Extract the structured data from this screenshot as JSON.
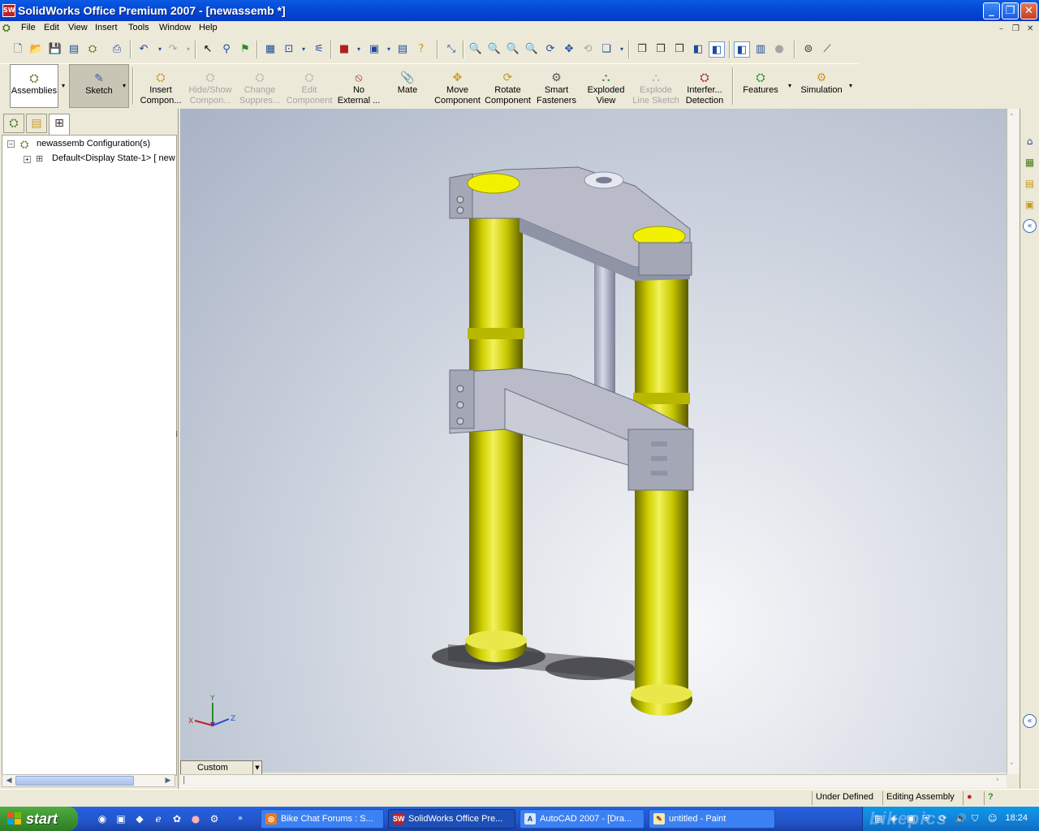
{
  "window": {
    "title": "SolidWorks Office Premium 2007 - [newassemb *]",
    "app_icon": "SW"
  },
  "menu": [
    "File",
    "Edit",
    "View",
    "Insert",
    "Tools",
    "Window",
    "Help"
  ],
  "command_manager": {
    "items": [
      {
        "label1": "Assemblies",
        "label2": "",
        "state": "active",
        "icon": "assembly-icon"
      },
      {
        "label1": "Sketch",
        "label2": "",
        "state": "selected",
        "icon": "sketch-icon"
      },
      {
        "label1": "Insert",
        "label2": "Compon...",
        "state": "enabled",
        "icon": "insert-component-icon"
      },
      {
        "label1": "Hide/Show",
        "label2": "Compon...",
        "state": "disabled",
        "icon": "hide-show-icon"
      },
      {
        "label1": "Change",
        "label2": "Suppres...",
        "state": "disabled",
        "icon": "change-suppression-icon"
      },
      {
        "label1": "Edit",
        "label2": "Component",
        "state": "disabled",
        "icon": "edit-component-icon"
      },
      {
        "label1": "No",
        "label2": "External ...",
        "state": "enabled",
        "icon": "no-external-icon"
      },
      {
        "label1": "Mate",
        "label2": "",
        "state": "enabled",
        "icon": "mate-icon"
      },
      {
        "label1": "Move",
        "label2": "Component",
        "state": "enabled",
        "icon": "move-component-icon"
      },
      {
        "label1": "Rotate",
        "label2": "Component",
        "state": "enabled",
        "icon": "rotate-component-icon"
      },
      {
        "label1": "Smart",
        "label2": "Fasteners",
        "state": "enabled",
        "icon": "smart-fasteners-icon"
      },
      {
        "label1": "Exploded",
        "label2": "View",
        "state": "enabled",
        "icon": "exploded-view-icon"
      },
      {
        "label1": "Explode",
        "label2": "Line Sketch",
        "state": "disabled",
        "icon": "explode-line-sketch-icon"
      },
      {
        "label1": "Interfer...",
        "label2": "Detection",
        "state": "enabled",
        "icon": "interference-detection-icon"
      },
      {
        "label1": "Features",
        "label2": "",
        "state": "enabled",
        "icon": "features-icon"
      },
      {
        "label1": "Simulation",
        "label2": "",
        "state": "enabled",
        "icon": "simulation-icon"
      }
    ]
  },
  "feature_manager": {
    "tree": [
      {
        "label": "newassemb Configuration(s)",
        "icon": "configuration-icon",
        "expander": "−"
      },
      {
        "label": "Default<Display State-1> [ new",
        "icon": "config-item-icon",
        "expander": "+"
      }
    ]
  },
  "viewport": {
    "config_tab": "Custom",
    "triad_axes": [
      "Y",
      "X",
      "Z"
    ],
    "background_top": "#A9B3C6",
    "background_center": "#F6F7F9",
    "model_color": "#D8D800"
  },
  "status": {
    "defined": "Under Defined",
    "mode": "Editing Assembly"
  },
  "taskbar": {
    "start_label": "start",
    "tasks": [
      {
        "label": "Bike Chat Forums : S...",
        "icon": "firefox-icon",
        "active": false
      },
      {
        "label": "SolidWorks Office Pre...",
        "icon": "solidworks-icon",
        "active": true
      },
      {
        "label": "AutoCAD 2007 - [Dra...",
        "icon": "autocad-icon",
        "active": false
      },
      {
        "label": "untitled - Paint",
        "icon": "paint-icon",
        "active": false
      }
    ],
    "clock": "18:24",
    "watermark": "bikepics"
  }
}
